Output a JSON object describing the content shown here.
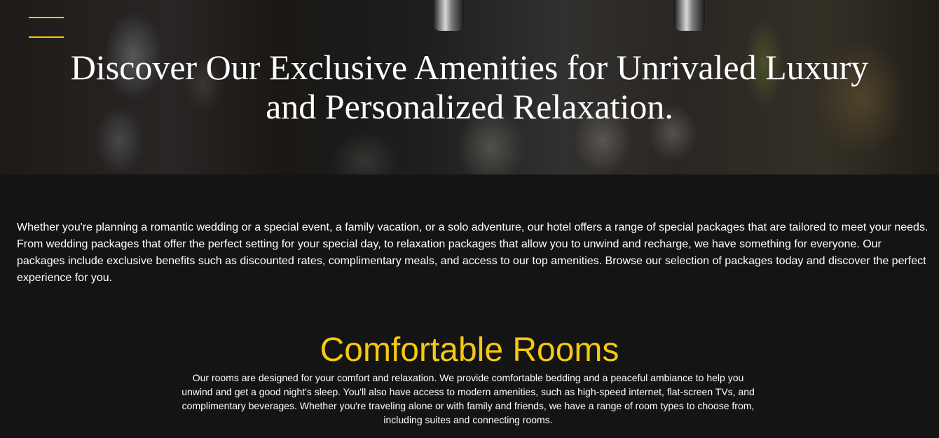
{
  "hero": {
    "title": "Discover Our Exclusive Amenities for Unrivaled Luxury and Personalized Relaxation."
  },
  "menu": {
    "icon": "hamburger-menu-icon",
    "accent_color": "#f2c811"
  },
  "intro": {
    "text": "Whether you're planning a romantic wedding or a special event, a family vacation, or a solo adventure, our hotel offers a range of special packages that are tailored to meet your needs. From wedding packages that offer the perfect setting for your special day, to relaxation packages that allow you to unwind and recharge, we have something for everyone. Our packages include exclusive benefits such as discounted rates, complimentary meals, and access to our top amenities. Browse our selection of packages today and discover the perfect experience for you."
  },
  "rooms": {
    "title": "Comfortable Rooms",
    "text": "Our rooms are designed for your comfort and relaxation. We provide comfortable bedding and a peaceful ambiance to help you unwind and get a good night's sleep. You'll also have access to modern amenities, such as high-speed internet, flat-screen TVs, and complimentary beverages. Whether you're traveling alone or with family and friends, we have a range of room types to choose from, including suites and connecting rooms."
  },
  "colors": {
    "background": "#141414",
    "heading_accent": "#f6c90e",
    "text": "#ffffff"
  }
}
